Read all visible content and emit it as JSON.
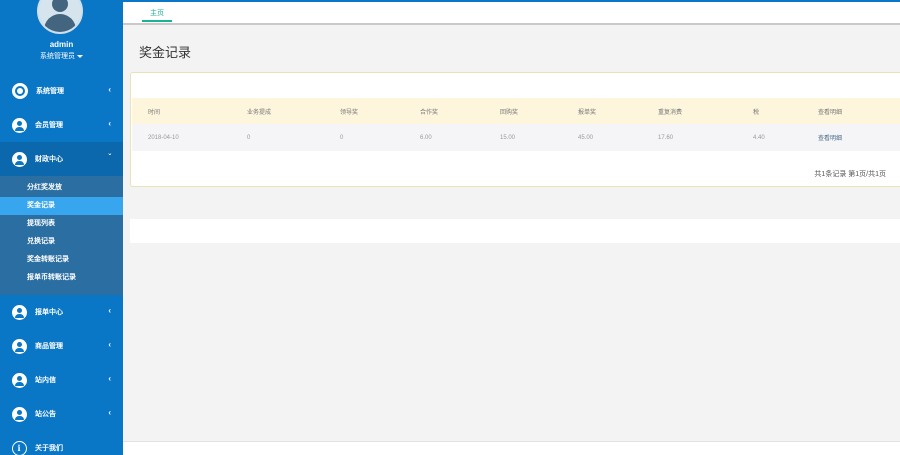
{
  "sidebar": {
    "user": {
      "name": "admin",
      "role": "系统管理员"
    },
    "menu_before": [
      {
        "label": "系统管理",
        "icon": "gear-icon"
      },
      {
        "label": "会员管理",
        "icon": "user-icon"
      }
    ],
    "finance": {
      "label": "财政中心",
      "items": [
        "分红奖发放",
        "奖金记录",
        "提现列表",
        "兑换记录",
        "奖金转账记录",
        "报单币转账记录"
      ]
    },
    "menu_after": [
      {
        "label": "报单中心",
        "icon": "user-icon"
      },
      {
        "label": "商品管理",
        "icon": "user-icon"
      },
      {
        "label": "站内信",
        "icon": "user-icon"
      },
      {
        "label": "站公告",
        "icon": "user-icon"
      },
      {
        "label": "关于我们",
        "icon": "info-icon"
      }
    ]
  },
  "topbar": {
    "tab_home": "主页"
  },
  "main": {
    "title": "奖金记录",
    "table": {
      "headers": [
        "时间",
        "业务提成",
        "领导奖",
        "合作奖",
        "回购奖",
        "报单奖",
        "重复消费",
        "税",
        "查看明细"
      ],
      "rows": [
        [
          "2018-04-10",
          "0",
          "0",
          "6.00",
          "15.00",
          "45.00",
          "17.60",
          "4.40",
          "查看明细"
        ]
      ]
    },
    "pagination": "共1条记录 第1页/共1页"
  }
}
